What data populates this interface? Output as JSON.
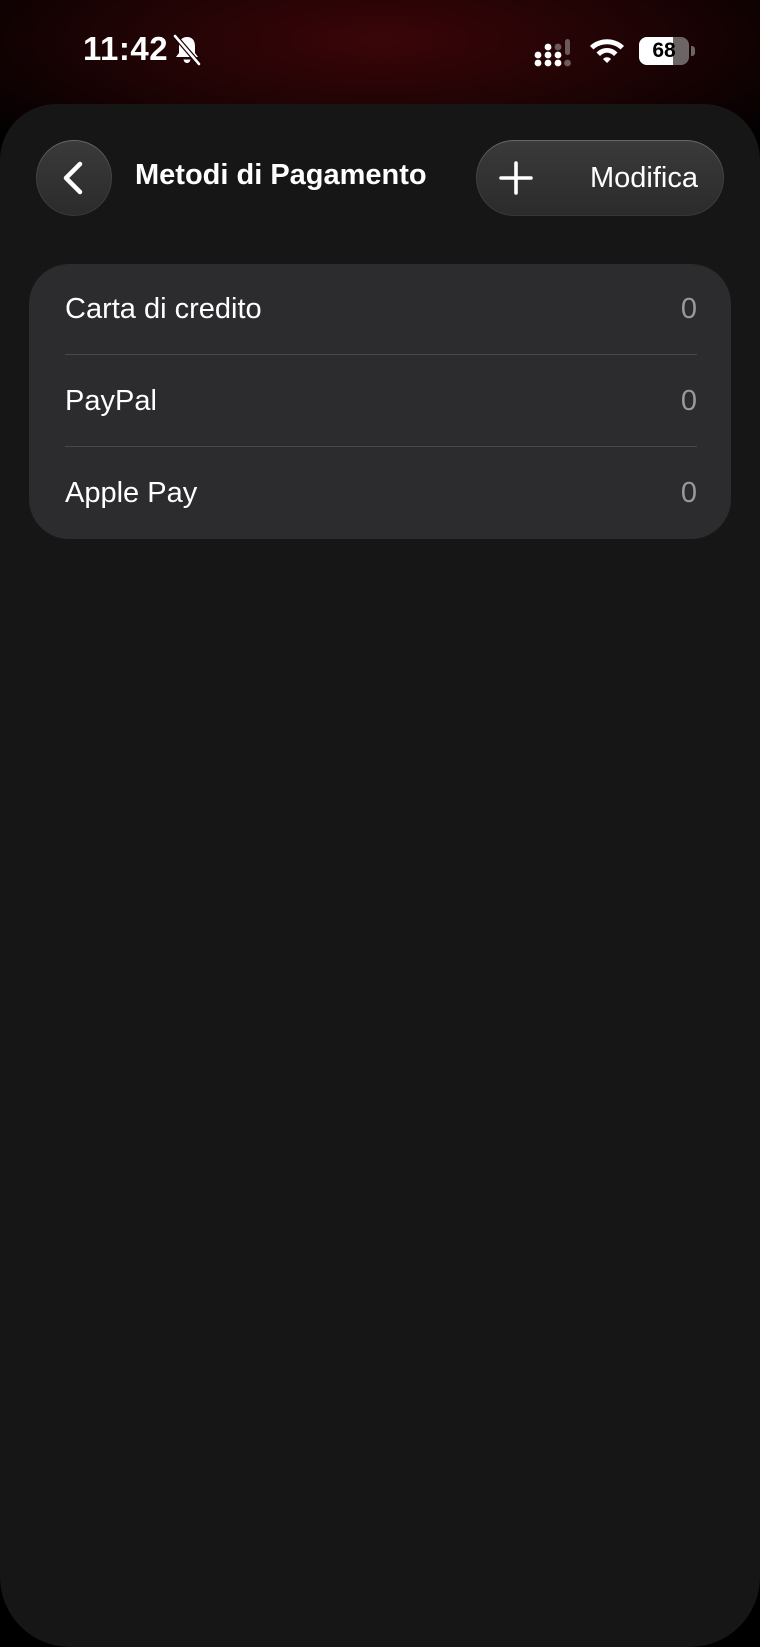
{
  "status_bar": {
    "time": "11:42",
    "battery_level": "68",
    "battery_fraction": 0.68,
    "icons": [
      "bell-slash-icon",
      "signal-icon",
      "wifi-icon",
      "battery-icon"
    ]
  },
  "header": {
    "title": "Metodi di Pagamento",
    "back_icon": "chevron-left-icon",
    "add_icon": "plus-icon",
    "edit_label": "Modifica"
  },
  "payment_methods": [
    {
      "label": "Carta di credito",
      "count": "0"
    },
    {
      "label": "PayPal",
      "count": "0"
    },
    {
      "label": "Apple Pay",
      "count": "0"
    }
  ],
  "colors": {
    "sheet_background": "#161616",
    "list_background": "#2c2c2e",
    "secondary_text": "#98989d",
    "accent_glow": "#3a0508"
  }
}
